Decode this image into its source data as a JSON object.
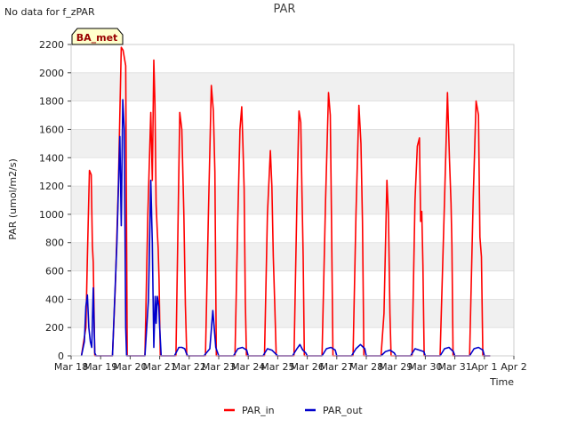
{
  "header": {
    "note": "No data for f_zPAR"
  },
  "colors": {
    "PAR_in": "#ff0000",
    "PAR_out": "#0000cc",
    "band": "#f0f0f0",
    "badge_bg": "#ffffcc",
    "badge_text": "#990000"
  },
  "chart_data": {
    "type": "line",
    "title": "PAR",
    "xlabel": "Time",
    "ylabel": "PAR (umol/m2/s)",
    "ylim": [
      0,
      2200
    ],
    "xlim": [
      0,
      15
    ],
    "yticks": [
      0,
      200,
      400,
      600,
      800,
      1000,
      1200,
      1400,
      1600,
      1800,
      2000,
      2200
    ],
    "xtick_labels": [
      "Mar 18",
      "Mar 19",
      "Mar 20",
      "Mar 21",
      "Mar 22",
      "Mar 23",
      "Mar 24",
      "Mar 25",
      "Mar 26",
      "Mar 27",
      "Mar 28",
      "Mar 29",
      "Mar 30",
      "Mar 31",
      "Apr 1",
      "Apr 2"
    ],
    "legend_position": "bottom-center",
    "badge": "BA_met",
    "series": [
      {
        "name": "PAR_in",
        "x": [
          0.35,
          0.5,
          0.55,
          0.62,
          0.68,
          0.72,
          0.75,
          0.8,
          0.84,
          0.88,
          0.92,
          0.97,
          1.05,
          1.4,
          1.5,
          1.6,
          1.7,
          1.76,
          1.85,
          1.9,
          1.95,
          2.0,
          2.05,
          2.15,
          2.3,
          2.5,
          2.6,
          2.7,
          2.75,
          2.8,
          2.84,
          2.88,
          2.92,
          2.95,
          2.98,
          3.02,
          3.05,
          3.1,
          3.15,
          3.2,
          3.3,
          3.55,
          3.68,
          3.75,
          3.82,
          3.87,
          3.92,
          3.95,
          4.0,
          4.05,
          4.2,
          4.55,
          4.65,
          4.75,
          4.82,
          4.87,
          4.92,
          4.97,
          5.05,
          5.2,
          5.55,
          5.65,
          5.72,
          5.78,
          5.82,
          5.86,
          5.9,
          5.94,
          5.97,
          6.0,
          6.05,
          6.15,
          6.55,
          6.65,
          6.75,
          6.8,
          6.85,
          6.9,
          6.95,
          7.0,
          7.05,
          7.15,
          7.55,
          7.65,
          7.72,
          7.78,
          7.82,
          7.86,
          7.9,
          7.95,
          8.0,
          8.1,
          8.5,
          8.62,
          8.72,
          8.78,
          8.82,
          8.87,
          8.92,
          8.96,
          9.02,
          9.15,
          9.55,
          9.65,
          9.75,
          9.82,
          9.87,
          9.92,
          9.96,
          10.0,
          10.15,
          10.5,
          10.6,
          10.7,
          10.75,
          10.8,
          10.84,
          10.88,
          10.93,
          10.98,
          11.05,
          11.2,
          11.55,
          11.65,
          11.73,
          11.8,
          11.84,
          11.88,
          11.92,
          11.96,
          12.0,
          12.1,
          12.5,
          12.65,
          12.75,
          12.82,
          12.87,
          12.9,
          12.94,
          12.98,
          13.05,
          13.15,
          13.5,
          13.62,
          13.72,
          13.8,
          13.85,
          13.9,
          13.95,
          14.0,
          14.05,
          14.15
        ],
        "values": [
          0,
          200,
          700,
          1310,
          1280,
          780,
          660,
          0,
          0,
          0,
          0,
          0,
          0,
          0,
          500,
          1200,
          2180,
          2160,
          2050,
          0,
          0,
          0,
          0,
          0,
          0,
          0,
          1000,
          1720,
          1240,
          2090,
          1780,
          1070,
          880,
          760,
          540,
          0,
          0,
          0,
          0,
          0,
          0,
          0,
          1720,
          1600,
          1000,
          360,
          0,
          0,
          0,
          0,
          0,
          0,
          1000,
          1910,
          1730,
          1300,
          0,
          0,
          0,
          0,
          0,
          1000,
          1600,
          1760,
          1500,
          1180,
          400,
          0,
          0,
          0,
          0,
          0,
          0,
          1000,
          1450,
          1200,
          700,
          350,
          0,
          0,
          0,
          0,
          0,
          1100,
          1730,
          1650,
          1170,
          700,
          0,
          0,
          0,
          0,
          0,
          1100,
          1860,
          1700,
          1000,
          0,
          0,
          0,
          0,
          0,
          0,
          1000,
          1770,
          1500,
          950,
          0,
          0,
          0,
          0,
          0,
          300,
          1240,
          1000,
          300,
          0,
          0,
          0,
          0,
          0,
          0,
          0,
          1100,
          1480,
          1540,
          950,
          1020,
          640,
          0,
          0,
          0,
          0,
          1100,
          1860,
          1380,
          1080,
          780,
          0,
          0,
          0,
          0,
          0,
          1100,
          1800,
          1700,
          840,
          700,
          0,
          0,
          0,
          0
        ]
      },
      {
        "name": "PAR_out",
        "x": [
          0.35,
          0.45,
          0.5,
          0.55,
          0.6,
          0.65,
          0.7,
          0.75,
          0.8,
          0.85,
          1.4,
          1.55,
          1.65,
          1.7,
          1.75,
          1.8,
          1.85,
          1.88,
          1.92,
          1.98,
          2.5,
          2.62,
          2.7,
          2.75,
          2.8,
          2.85,
          2.88,
          2.92,
          2.97,
          3.0,
          3.05,
          3.1,
          3.5,
          3.65,
          3.75,
          3.85,
          3.9,
          3.95,
          4.5,
          4.7,
          4.8,
          4.9,
          5.0,
          5.5,
          5.65,
          5.8,
          5.95,
          6.0,
          6.5,
          6.65,
          6.8,
          6.9,
          7.0,
          7.5,
          7.65,
          7.75,
          7.85,
          7.95,
          8.0,
          8.5,
          8.65,
          8.8,
          8.95,
          9.0,
          9.5,
          9.65,
          9.8,
          9.95,
          10.0,
          10.5,
          10.65,
          10.8,
          10.95,
          11.0,
          11.5,
          11.65,
          11.8,
          11.95,
          12.0,
          12.5,
          12.65,
          12.8,
          12.95,
          13.0,
          13.5,
          13.65,
          13.8,
          13.95,
          14.0
        ],
        "values": [
          0,
          100,
          350,
          430,
          200,
          100,
          60,
          480,
          20,
          0,
          0,
          800,
          1550,
          920,
          1810,
          1600,
          200,
          0,
          0,
          0,
          0,
          400,
          1240,
          800,
          60,
          420,
          230,
          420,
          350,
          200,
          0,
          0,
          0,
          60,
          60,
          50,
          20,
          0,
          0,
          50,
          320,
          60,
          0,
          0,
          50,
          60,
          40,
          0,
          0,
          50,
          40,
          20,
          0,
          0,
          50,
          80,
          40,
          20,
          0,
          0,
          50,
          60,
          40,
          0,
          0,
          50,
          80,
          50,
          0,
          0,
          30,
          40,
          20,
          0,
          0,
          50,
          40,
          30,
          0,
          0,
          50,
          60,
          30,
          0,
          0,
          50,
          60,
          40,
          0
        ]
      }
    ]
  }
}
